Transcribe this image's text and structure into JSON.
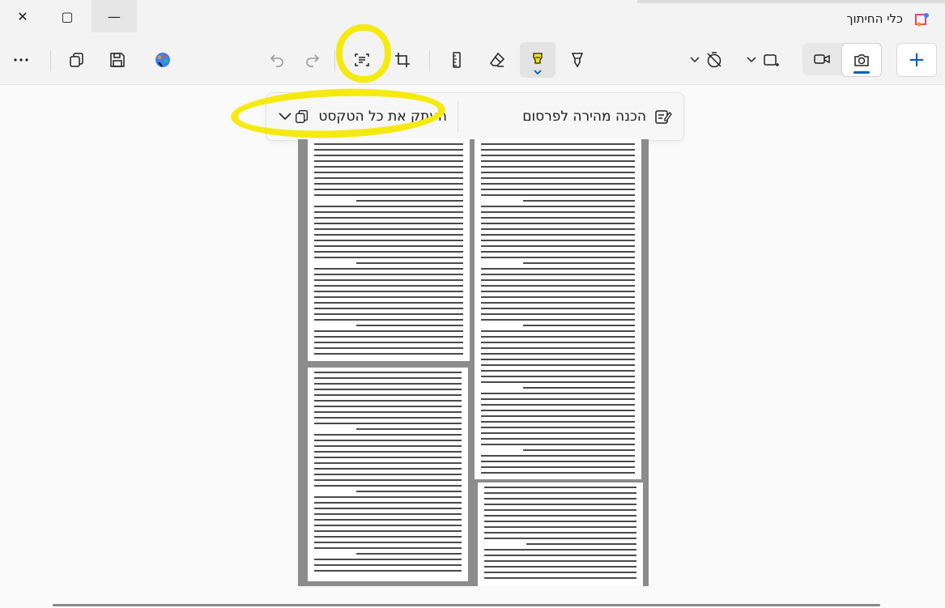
{
  "window": {
    "title": "כלי החיתוך",
    "minimize_label": "—",
    "maximize_label": "▢",
    "close_label": "✕"
  },
  "toolbar": {
    "more_icon": "more-icon",
    "copy_icon": "copy-icon",
    "save_icon": "save-icon",
    "paint_icon": "paint-icon",
    "undo_icon": "undo-icon",
    "redo_icon": "redo-icon",
    "text_actions_icon": "text-actions-icon",
    "crop_icon": "crop-icon",
    "ruler_icon": "ruler-icon",
    "eraser_icon": "eraser-icon",
    "highlighter_icon": "highlighter-icon",
    "pen_icon": "pen-icon",
    "delay_icon": "timer-off-icon",
    "shape_icon": "rectangle-snip-icon",
    "video_icon": "video-icon",
    "camera_icon": "camera-icon",
    "new_label": "+"
  },
  "text_actions": {
    "copy_all": "העתק את כל הטקסט",
    "quick_redact": "הכנה מהירה לפרסום"
  },
  "colors": {
    "accent": "#005fb8",
    "highlighter": "#f5ea10"
  }
}
